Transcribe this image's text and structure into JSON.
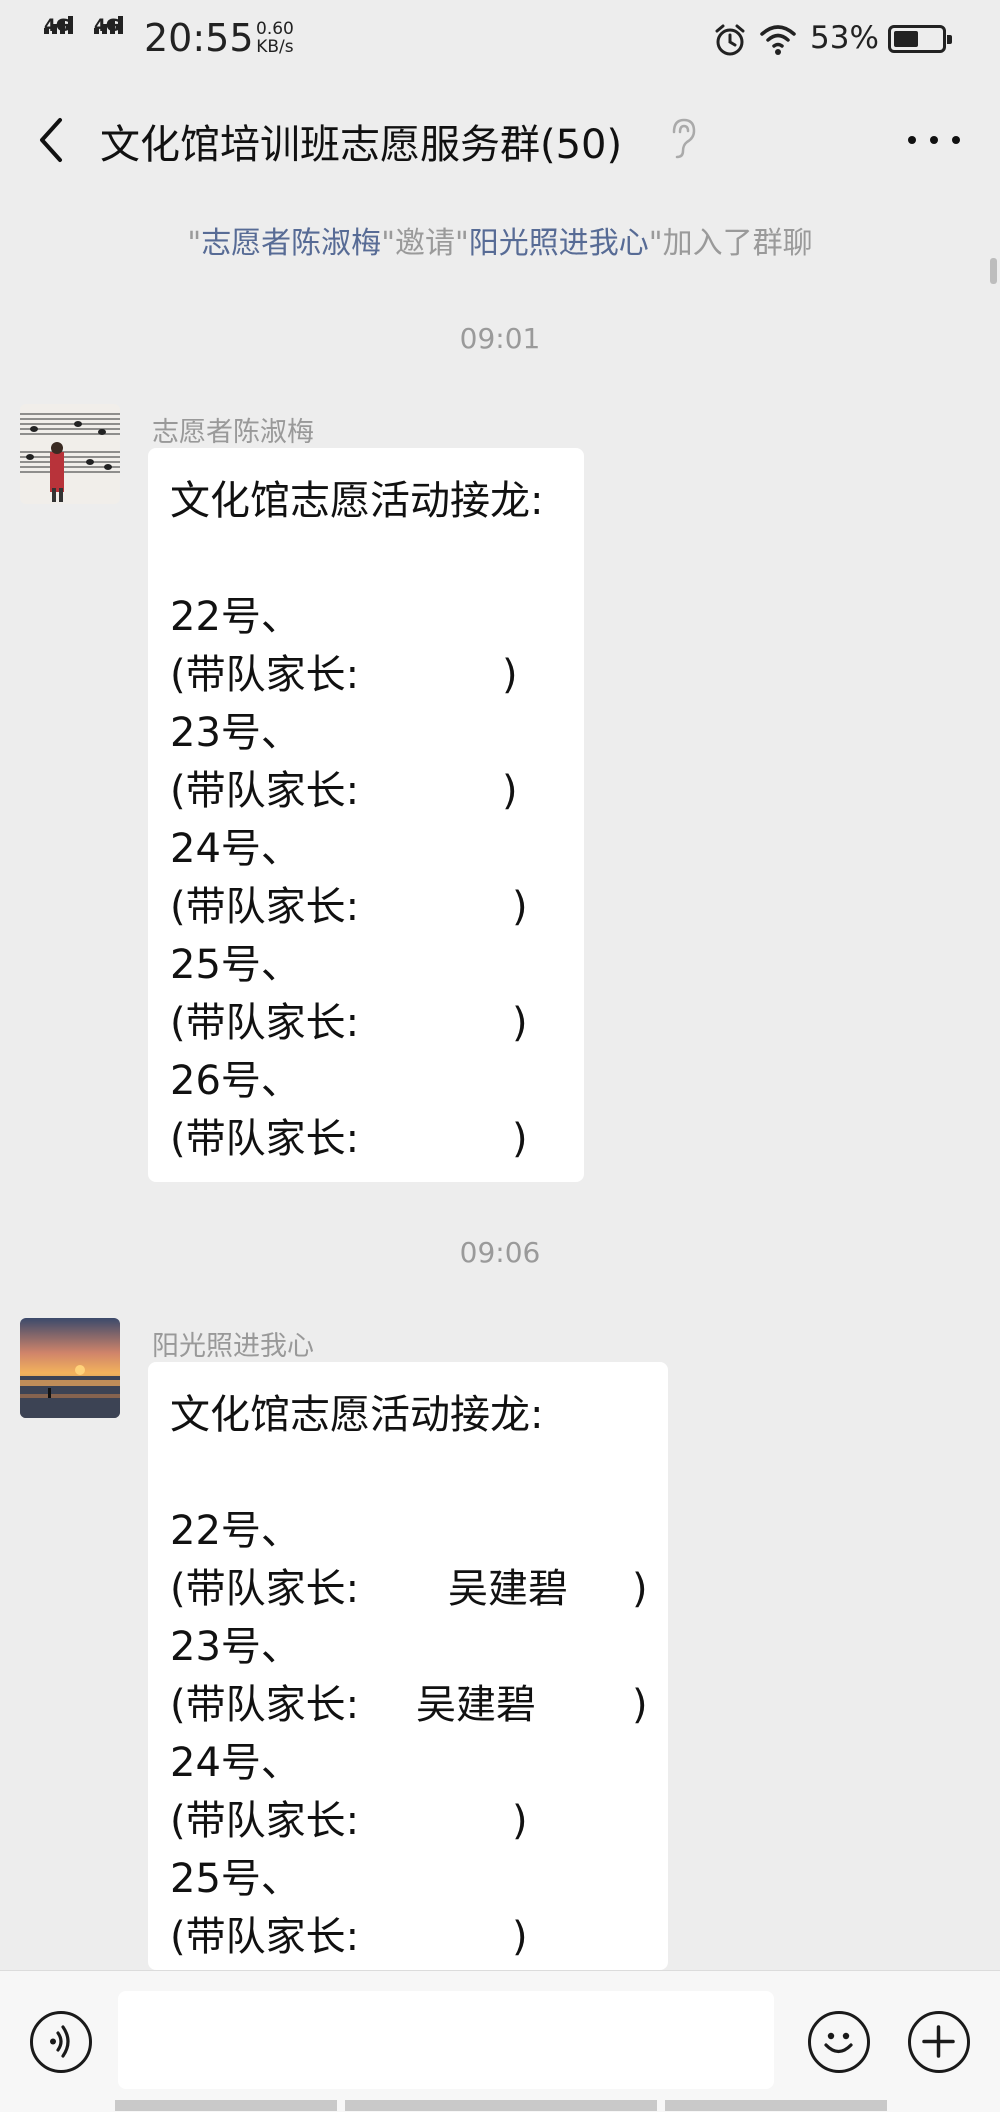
{
  "status_bar": {
    "network_1": "4G",
    "network_2": "4G",
    "time": "20:55",
    "speed_value": "0.60",
    "speed_unit": "KB/s",
    "battery_percent": "53%",
    "battery_level": 0.53,
    "icons": [
      "alarm-icon",
      "wifi-icon",
      "battery-icon"
    ]
  },
  "header": {
    "back_icon": "chevron-left-icon",
    "title": "文化馆培训班志愿服务群(50)",
    "mute_icon": "ear-icon",
    "more_icon": "more-icon"
  },
  "system_message": {
    "quote1": "\"",
    "inviter": "志愿者陈淑梅",
    "mid": "\"邀请\"",
    "invitee": "阳光照进我心",
    "end": "\"加入了群聊"
  },
  "messages": [
    {
      "time": "09:01",
      "sender": "志愿者陈淑梅",
      "title": "文化馆志愿活动接龙:",
      "entries": [
        {
          "num": "22号、",
          "label": "(带队家长:",
          "name": "",
          "close": ")"
        },
        {
          "num": "23号、",
          "label": "(带队家长:",
          "name": "",
          "close": ")"
        },
        {
          "num": "24号、",
          "label": "(带队家长:",
          "name": "",
          "close": ")"
        },
        {
          "num": "25号、",
          "label": "(带队家长:",
          "name": "",
          "close": ")"
        },
        {
          "num": "26号、",
          "label": "(带队家长:",
          "name": "",
          "close": ")"
        }
      ]
    },
    {
      "time": "09:06",
      "sender": "阳光照进我心",
      "title": "文化馆志愿活动接龙:",
      "entries": [
        {
          "num": "22号、",
          "label": "(带队家长:",
          "name": "吴建碧",
          "close": ")"
        },
        {
          "num": "23号、",
          "label": "(带队家长:",
          "name": "吴建碧",
          "close": ")"
        },
        {
          "num": "24号、",
          "label": "(带队家长:",
          "name": "",
          "close": ")"
        },
        {
          "num": "25号、",
          "label": "(带队家长:",
          "name": "",
          "close": ")"
        }
      ]
    }
  ],
  "input_bar": {
    "voice_icon": "voice-icon",
    "text_value": "",
    "emoji_icon": "emoji-icon",
    "add_icon": "plus-icon"
  }
}
